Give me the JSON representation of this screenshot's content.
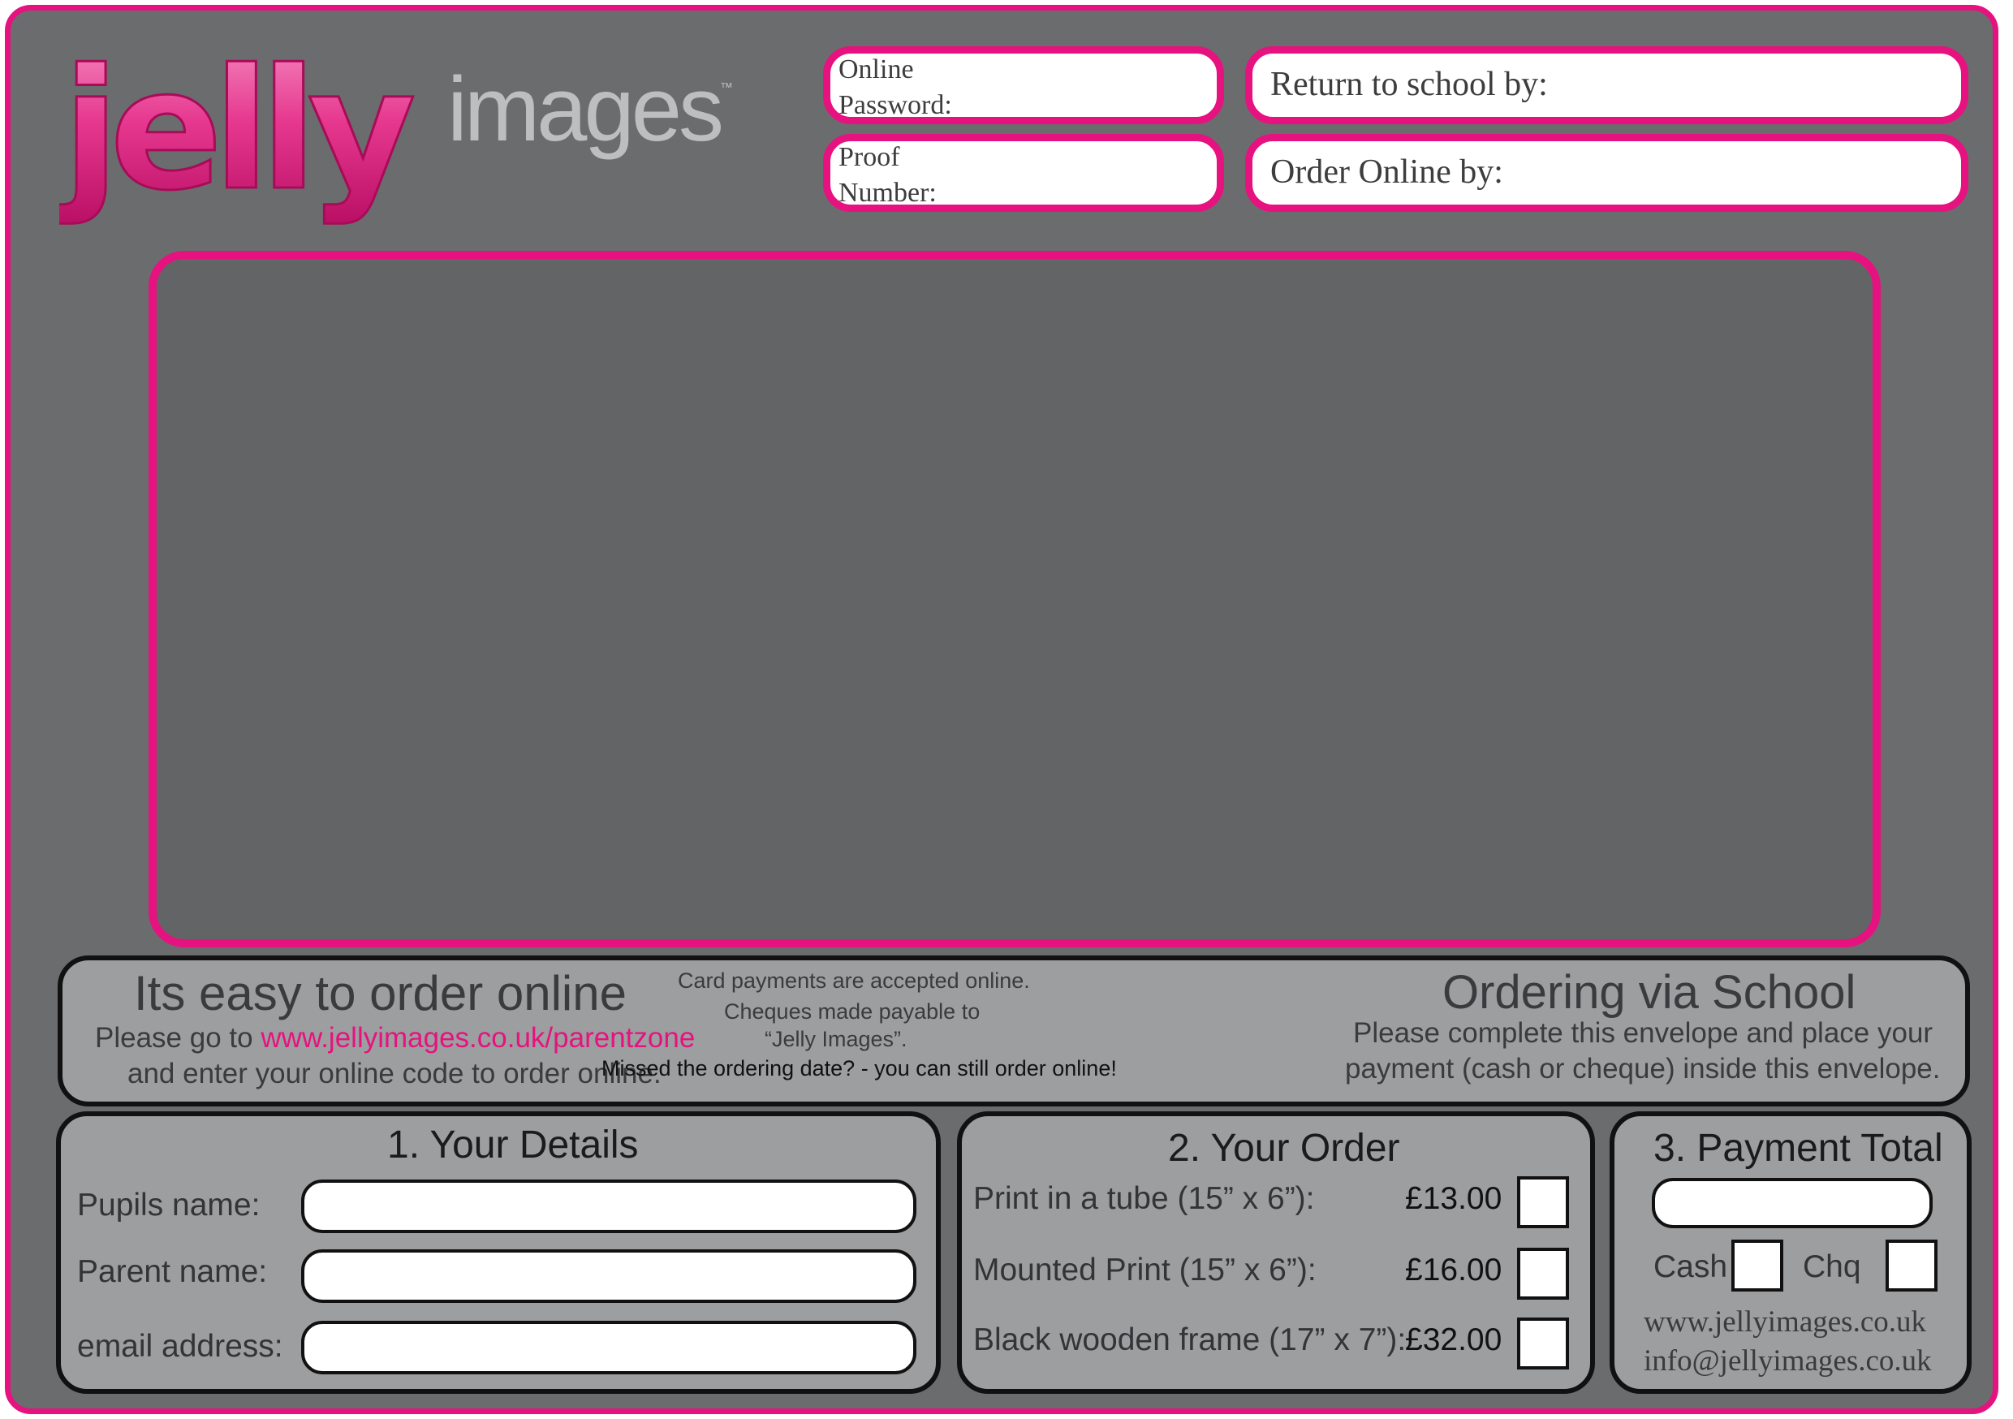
{
  "brand": {
    "logo_main": "jelly",
    "logo_sub": "images",
    "trademark": "™"
  },
  "header_fields": {
    "online_password_line1": "Online",
    "online_password_line2": "Password:",
    "proof_number_line1": "Proof",
    "proof_number_line2": "Number:",
    "return_by_label": "Return to school by:",
    "order_online_by_label": "Order Online by:"
  },
  "info": {
    "online_title": "Its easy to order online",
    "online_go_prefix": "Please go to ",
    "online_url": "www.jellyimages.co.uk/parentzone",
    "online_enter": "and enter your online code to order online.",
    "card_note": "Card payments are accepted online.",
    "cheque_note1": "Cheques made payable to",
    "cheque_note2": "“Jelly Images”.",
    "missed_note": "Missed the ordering date? - you can still order online!",
    "school_title": "Ordering via School",
    "school_line1": "Please complete this envelope and place your",
    "school_line2": "payment (cash or cheque) inside this envelope."
  },
  "details": {
    "title": "1. Your Details",
    "pupil_label": "Pupils name:",
    "parent_label": "Parent name:",
    "email_label": "email address:",
    "pupil_value": "",
    "parent_value": "",
    "email_value": ""
  },
  "order": {
    "title": "2. Your Order",
    "items": [
      {
        "label": "Print in a tube (15” x 6”):",
        "price": "£13.00",
        "checked": false
      },
      {
        "label": "Mounted Print (15” x 6”):",
        "price": "£16.00",
        "checked": false
      },
      {
        "label": "Black wooden frame (17” x 7”):",
        "price": "£32.00",
        "checked": false
      }
    ]
  },
  "payment": {
    "title": "3. Payment Total",
    "total_value": "",
    "cash_label": "Cash",
    "chq_label": "Chq",
    "website": "www.jellyimages.co.uk",
    "email": "info@jellyimages.co.uk"
  },
  "colors": {
    "accent": "#e6127f",
    "background": "#6b6c6e",
    "panel": "#9d9ea0"
  }
}
